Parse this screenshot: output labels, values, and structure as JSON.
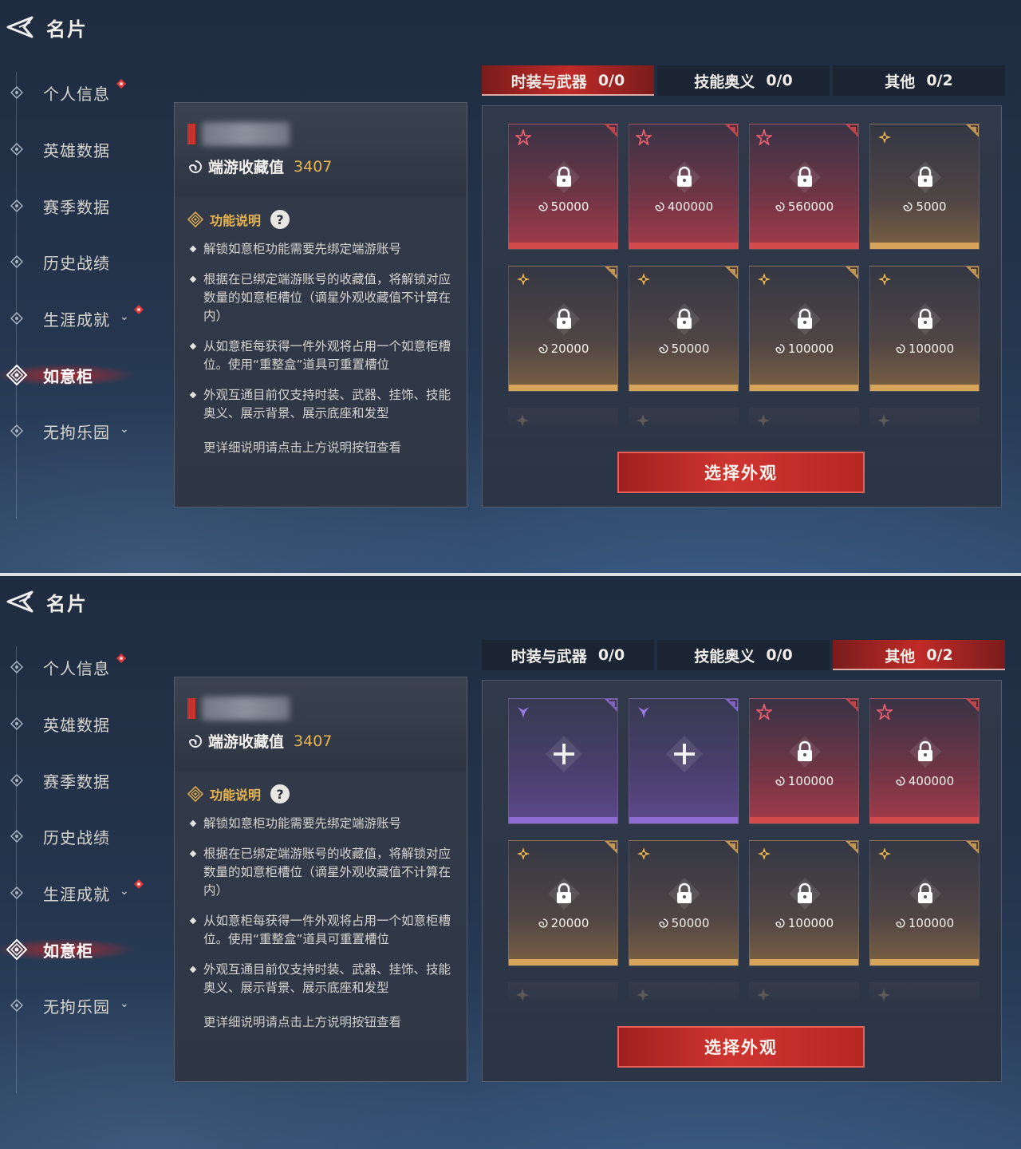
{
  "header": {
    "title": "名片"
  },
  "sidebar": {
    "items": [
      {
        "label": "个人信息"
      },
      {
        "label": "英雄数据"
      },
      {
        "label": "赛季数据"
      },
      {
        "label": "历史战绩"
      },
      {
        "label": "生涯成就"
      },
      {
        "label": "如意柜"
      },
      {
        "label": "无拘乐园"
      }
    ]
  },
  "info": {
    "collect_label": "端游收藏值",
    "collect_value": "3407",
    "func_label": "功能说明",
    "help_glyph": "?",
    "rules": [
      "解锁如意柜功能需要先绑定端游账号",
      "根据在已绑定端游账号的收藏值，将解锁对应数量的如意柜槽位（谪星外观收藏值不计算在内）",
      "从如意柜每获得一件外观将占用一个如意柜槽位。使用“重整盒”道具可重置槽位",
      "外观互通目前仅支持时装、武器、挂饰、技能奥义、展示背景、展示底座和发型"
    ],
    "note": "更详细说明请点击上方说明按钮查看"
  },
  "tabs": [
    {
      "label": "时装与武器",
      "count": "0/0"
    },
    {
      "label": "技能奥义",
      "count": "0/0"
    },
    {
      "label": "其他",
      "count": "0/2"
    }
  ],
  "select_button": "选择外观",
  "panels": {
    "top": {
      "active_tab": 0,
      "slots": [
        {
          "tier": "red",
          "cost": "50000"
        },
        {
          "tier": "red",
          "cost": "400000"
        },
        {
          "tier": "red",
          "cost": "560000"
        },
        {
          "tier": "gold",
          "cost": "5000"
        },
        {
          "tier": "gold",
          "cost": "20000"
        },
        {
          "tier": "gold",
          "cost": "50000"
        },
        {
          "tier": "gold",
          "cost": "100000"
        },
        {
          "tier": "gold",
          "cost": "100000"
        }
      ]
    },
    "bottom": {
      "active_tab": 2,
      "slots": [
        {
          "tier": "purple",
          "cost": ""
        },
        {
          "tier": "purple",
          "cost": ""
        },
        {
          "tier": "red",
          "cost": "100000"
        },
        {
          "tier": "red",
          "cost": "400000"
        },
        {
          "tier": "gold",
          "cost": "20000"
        },
        {
          "tier": "gold",
          "cost": "50000"
        },
        {
          "tier": "gold",
          "cost": "100000"
        },
        {
          "tier": "gold",
          "cost": "100000"
        }
      ]
    }
  },
  "colors": {
    "accent_red": "#c02a28",
    "gold_text": "#e8b450",
    "tier_red": "#d24a4c",
    "tier_gold": "#d6a45a",
    "tier_purple": "#8c6cd0"
  }
}
